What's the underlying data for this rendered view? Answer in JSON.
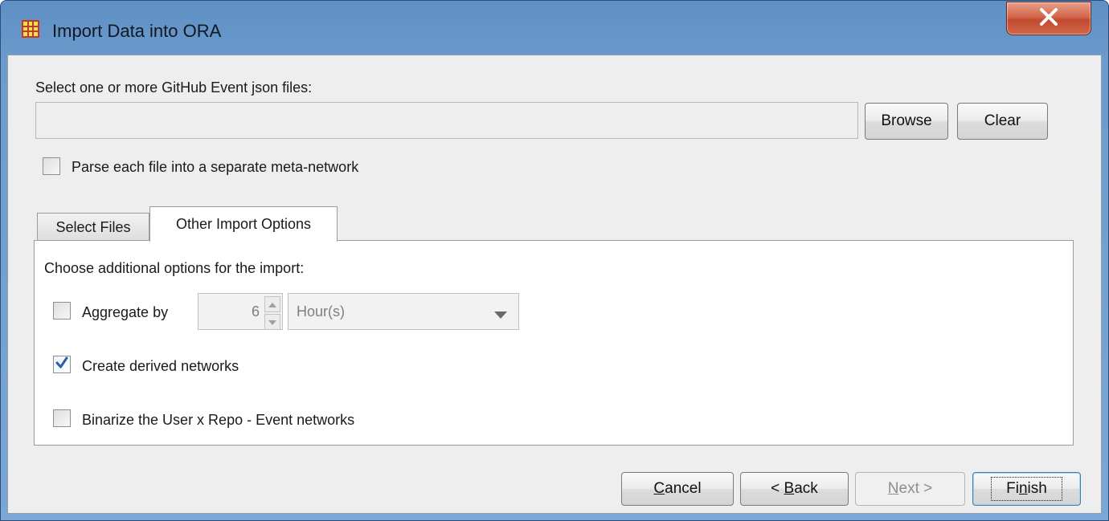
{
  "window": {
    "title": "Import Data into ORA",
    "icon": "ora-grid-icon",
    "close_icon": "close-x-icon"
  },
  "file_selection": {
    "label": "Select one or more GitHub Event json files:",
    "input_value": "",
    "browse_label": "Browse",
    "clear_label": "Clear"
  },
  "parse_option": {
    "label": "Parse each file into a separate meta-network",
    "checked": false
  },
  "tabs": [
    {
      "label": "Select Files",
      "active": false
    },
    {
      "label": "Other Import Options",
      "active": true
    }
  ],
  "other_options": {
    "heading": "Choose additional options for the import:",
    "aggregate": {
      "label": "Aggregate by",
      "checked": false,
      "value": "6",
      "unit": "Hour(s)",
      "enabled": false
    },
    "derived": {
      "label": "Create derived networks",
      "checked": true
    },
    "binarize": {
      "label": "Binarize the User x Repo - Event networks",
      "checked": false
    }
  },
  "footer": {
    "cancel": {
      "prefix": "",
      "mnemonic": "C",
      "suffix": "ancel"
    },
    "back": {
      "prefix": "< ",
      "mnemonic": "B",
      "suffix": "ack"
    },
    "next": {
      "prefix": "",
      "mnemonic": "N",
      "suffix": "ext >",
      "enabled": false
    },
    "finish": {
      "prefix": "Fi",
      "mnemonic": "n",
      "suffix": "ish",
      "default": true
    }
  },
  "colors": {
    "title_bar": "#6c9bcd",
    "client_bg": "#eeeeee",
    "close_button": "#c9553a",
    "check_mark": "#2c5da6"
  }
}
